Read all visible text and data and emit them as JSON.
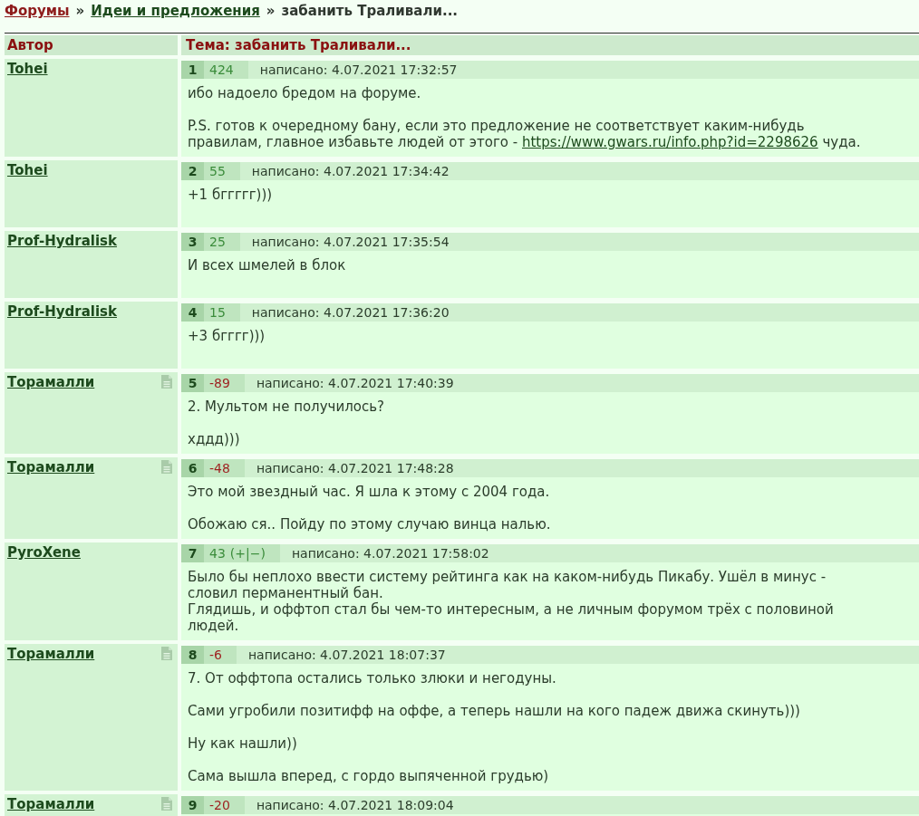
{
  "breadcrumb": [
    {
      "label": "Форумы",
      "kind": "root"
    },
    {
      "separator": "»",
      "label": "Идеи и предложения",
      "kind": "link"
    },
    {
      "separator": "»",
      "label": "забанить Траливали...",
      "kind": "current"
    }
  ],
  "table": {
    "columns": [
      "Автор",
      "Тема: забанить Траливали..."
    ]
  },
  "posts": [
    {
      "author": "Tohei",
      "document_icon": false,
      "number": "1",
      "rating": {
        "text": "424",
        "color": "#3b8c3b"
      },
      "date": "написано: 4.07.2021 17:32:57",
      "paragraphs": [
        {
          "lines": [
            {
              "text": "ибо надоело бредом на форуме."
            }
          ]
        },
        {
          "lines": [
            {
              "text": "P.S. готов к очередному бану, если это предложение не соответствует каким-нибудь правилам, главное избавьте людей от этого - ",
              "link": "https://www.gwars.ru/info.php?id=2298626",
              "text_after": " чуда."
            }
          ]
        }
      ]
    },
    {
      "author": "Tohei",
      "document_icon": false,
      "number": "2",
      "rating": {
        "text": "55",
        "color": "#3b8c3b"
      },
      "date": "написано: 4.07.2021 17:34:42",
      "paragraphs": [
        {
          "lines": [
            {
              "text": "+1 бггггг)))"
            }
          ]
        }
      ]
    },
    {
      "author": "Prof-Hydralisk",
      "document_icon": false,
      "number": "3",
      "rating": {
        "text": "25",
        "color": "#3b8c3b"
      },
      "date": "написано: 4.07.2021 17:35:54",
      "paragraphs": [
        {
          "lines": [
            {
              "text": "И всех шмелей в блок"
            }
          ]
        }
      ]
    },
    {
      "author": "Prof-Hydralisk",
      "document_icon": false,
      "number": "4",
      "rating": {
        "text": "15",
        "color": "#3b8c3b"
      },
      "date": "написано: 4.07.2021 17:36:20",
      "paragraphs": [
        {
          "lines": [
            {
              "text": "+3 бгггг)))"
            }
          ]
        }
      ]
    },
    {
      "author": "Торамалли",
      "document_icon": true,
      "number": "5",
      "rating": {
        "text": "-89",
        "color": "#9e1e1e"
      },
      "date": "написано: 4.07.2021 17:40:39",
      "paragraphs": [
        {
          "lines": [
            {
              "text": "2. Мультом не получилось?"
            }
          ]
        },
        {
          "lines": [
            {
              "text": "хддд)))"
            }
          ]
        }
      ]
    },
    {
      "author": "Торамалли",
      "document_icon": true,
      "number": "6",
      "rating": {
        "text": "-48",
        "color": "#9e1e1e"
      },
      "date": "написано: 4.07.2021 17:48:28",
      "paragraphs": [
        {
          "lines": [
            {
              "text": "Это мой звездный час. Я шла к этому с 2004 года."
            }
          ]
        },
        {
          "lines": [
            {
              "text": "Обожаю ся.. Пойду по этому случаю винца налью."
            }
          ]
        }
      ]
    },
    {
      "author": "PyroXene",
      "document_icon": false,
      "number": "7",
      "rating": {
        "text": "43",
        "color": "#3b8c3b"
      },
      "vote": "(+|−)",
      "date": "написано: 4.07.2021 17:58:02",
      "paragraphs": [
        {
          "lines": [
            {
              "text": "Было бы неплохо ввести систему рейтинга как на каком-нибудь Пикабу. Ушёл в минус - словил перманентный бан."
            },
            {
              "text": "Глядишь, и оффтоп стал бы чем-то интересным, а не личным форумом трёх с половиной людей."
            }
          ]
        }
      ]
    },
    {
      "author": "Торамалли",
      "document_icon": true,
      "number": "8",
      "rating": {
        "text": "-6",
        "color": "#9e1e1e"
      },
      "date": "написано: 4.07.2021 18:07:37",
      "paragraphs": [
        {
          "lines": [
            {
              "text": "7. От оффтопа остались только злюки и негодуны."
            }
          ]
        },
        {
          "lines": [
            {
              "text": "Сами угробили позитифф на оффе, а теперь нашли на кого падеж движа скинуть)))"
            }
          ]
        },
        {
          "lines": [
            {
              "text": "Ну как нашли))"
            }
          ]
        },
        {
          "lines": [
            {
              "text": "Сама вышла вперед, с гордо выпяченной грудью)"
            }
          ]
        }
      ]
    },
    {
      "author": "Торамалли",
      "document_icon": true,
      "number": "9",
      "rating": {
        "text": "-20",
        "color": "#9e1e1e"
      },
      "date": "написано: 4.07.2021 18:09:04"
    }
  ]
}
